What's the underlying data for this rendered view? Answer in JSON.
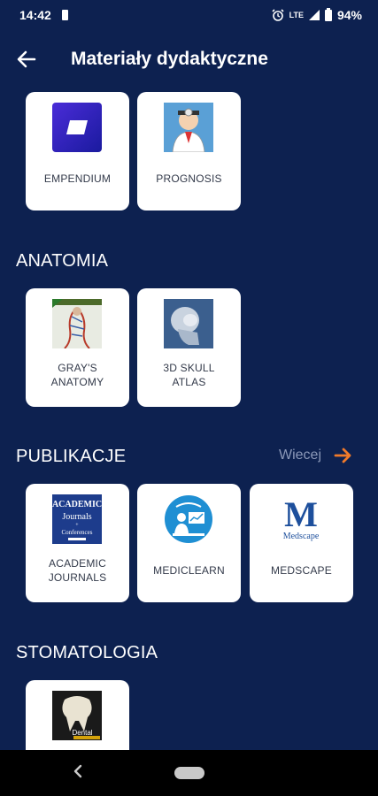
{
  "status_bar": {
    "time": "14:42",
    "network": "LTE",
    "battery": "94%"
  },
  "toolbar": {
    "title": "Materiały dydaktyczne",
    "back_icon": "arrow-left-icon"
  },
  "top_items": [
    {
      "label": "EMPENDIUM",
      "icon": "empendium-logo"
    },
    {
      "label": "PROGNOSIS",
      "icon": "prognosis-doctor"
    }
  ],
  "sections": {
    "anatomia": {
      "title": "ANATOMIA",
      "items": [
        {
          "label_line1": "GRAY'S",
          "label_line2": "ANATOMY",
          "icon": "grays-anatomy-cover"
        },
        {
          "label_line1": "3D SKULL",
          "label_line2": "ATLAS",
          "icon": "skull-xray"
        }
      ]
    },
    "publikacje": {
      "title": "PUBLIKACJE",
      "more_label": "Wiecej",
      "items": [
        {
          "label_line1": "ACADEMIC",
          "label_line2": "JOURNALS",
          "icon": "academic-journals-logo",
          "logo_line1": "ACADEMIC",
          "logo_line2": "Journals",
          "logo_line3": "Conferences"
        },
        {
          "label": "MEDICLEARN",
          "icon": "mediclearn-logo"
        },
        {
          "label": "MEDSCAPE",
          "icon": "medscape-logo",
          "logo_letter": "M",
          "logo_word": "Medscape"
        }
      ]
    },
    "stomatologia": {
      "title": "STOMATOLOGIA",
      "items": [
        {
          "label": "",
          "icon": "dental-tooth",
          "logo_word": "Dental"
        }
      ]
    }
  },
  "colors": {
    "background": "#0d2150",
    "tile": "#ffffff",
    "accent": "#f07a2a",
    "muted": "#8b98b8"
  }
}
